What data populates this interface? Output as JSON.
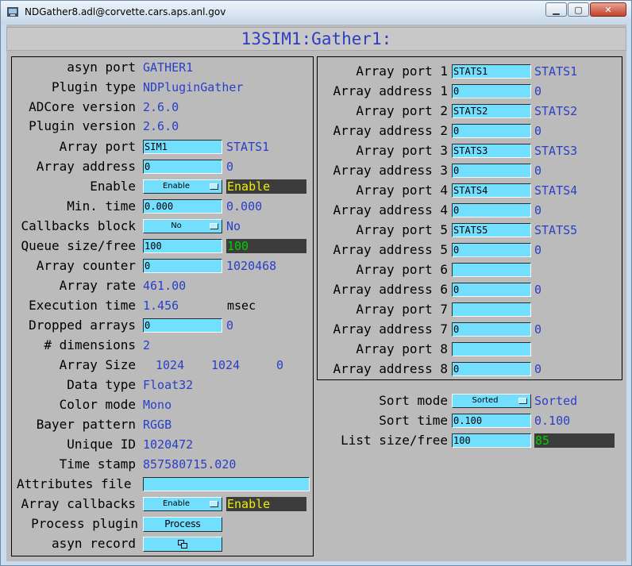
{
  "window": {
    "title": "NDGather8.adl@corvette.cars.aps.anl.gov",
    "controls": {
      "minimize": "▁",
      "maximize": "▢",
      "close": "✕"
    }
  },
  "header": {
    "title": "13SIM1:Gather1:"
  },
  "left": {
    "asyn_port": {
      "label": "asyn port",
      "value": "GATHER1"
    },
    "plugin_type": {
      "label": "Plugin type",
      "value": "NDPluginGather"
    },
    "adcore_version": {
      "label": "ADCore version",
      "value": "2.6.0"
    },
    "plugin_version": {
      "label": "Plugin version",
      "value": "2.6.0"
    },
    "array_port": {
      "label": "Array port",
      "input": "SIM1",
      "readback": "STATS1"
    },
    "array_address": {
      "label": "Array address",
      "input": "0",
      "readback": "0"
    },
    "enable": {
      "label": "Enable",
      "menu": "Enable",
      "readback": "Enable"
    },
    "min_time": {
      "label": "Min. time",
      "input": "0.000",
      "readback": "0.000"
    },
    "callbacks_block": {
      "label": "Callbacks block",
      "menu": "No",
      "readback": "No"
    },
    "queue_size": {
      "label": "Queue size/free",
      "input": "100",
      "readback": "100"
    },
    "array_counter": {
      "label": "Array counter",
      "input": "0",
      "readback": "1020468"
    },
    "array_rate": {
      "label": "Array rate",
      "value": "461.00"
    },
    "execution_time": {
      "label": "Execution time",
      "value": "1.456",
      "unit": "msec"
    },
    "dropped_arrays": {
      "label": "Dropped arrays",
      "input": "0",
      "readback": "0"
    },
    "dimensions": {
      "label": "# dimensions",
      "value": "2"
    },
    "array_size": {
      "label": "Array Size",
      "x": "1024",
      "y": "1024",
      "z": "0"
    },
    "data_type": {
      "label": "Data type",
      "value": "Float32"
    },
    "color_mode": {
      "label": "Color mode",
      "value": "Mono"
    },
    "bayer_pattern": {
      "label": "Bayer pattern",
      "value": "RGGB"
    },
    "unique_id": {
      "label": "Unique ID",
      "value": "1020472"
    },
    "time_stamp": {
      "label": "Time stamp",
      "value": "857580715.020"
    },
    "attributes_file": {
      "label": "Attributes file",
      "input": ""
    },
    "array_callbacks": {
      "label": "Array callbacks",
      "menu": "Enable",
      "readback": "Enable"
    },
    "process_plugin": {
      "label": "Process plugin",
      "button": "Process"
    },
    "asyn_record": {
      "label": "asyn record",
      "button_icon": "window-stack-icon"
    }
  },
  "right": {
    "ports": [
      {
        "port_label": "Array port 1",
        "port_input": "STATS1",
        "port_readback": "STATS1",
        "addr_label": "Array address 1",
        "addr_input": "0",
        "addr_readback": "0"
      },
      {
        "port_label": "Array port 2",
        "port_input": "STATS2",
        "port_readback": "STATS2",
        "addr_label": "Array address 2",
        "addr_input": "0",
        "addr_readback": "0"
      },
      {
        "port_label": "Array port 3",
        "port_input": "STATS3",
        "port_readback": "STATS3",
        "addr_label": "Array address 3",
        "addr_input": "0",
        "addr_readback": "0"
      },
      {
        "port_label": "Array port 4",
        "port_input": "STATS4",
        "port_readback": "STATS4",
        "addr_label": "Array address 4",
        "addr_input": "0",
        "addr_readback": "0"
      },
      {
        "port_label": "Array port 5",
        "port_input": "STATS5",
        "port_readback": "STATS5",
        "addr_label": "Array address 5",
        "addr_input": "0",
        "addr_readback": "0"
      },
      {
        "port_label": "Array port 6",
        "port_input": "",
        "port_readback": "",
        "addr_label": "Array address 6",
        "addr_input": "0",
        "addr_readback": "0"
      },
      {
        "port_label": "Array port 7",
        "port_input": "",
        "port_readback": "",
        "addr_label": "Array address 7",
        "addr_input": "0",
        "addr_readback": "0"
      },
      {
        "port_label": "Array port 8",
        "port_input": "",
        "port_readback": "",
        "addr_label": "Array address 8",
        "addr_input": "0",
        "addr_readback": "0"
      }
    ],
    "sort_mode": {
      "label": "Sort mode",
      "menu": "Sorted",
      "readback": "Sorted"
    },
    "sort_time": {
      "label": "Sort time",
      "input": "0.100",
      "readback": "0.100"
    },
    "list_size": {
      "label": "List size/free",
      "input": "100",
      "readback": "85"
    }
  },
  "colors": {
    "input_bg": "#73dfff",
    "monitor_text": "#2a3fc8",
    "alarm_yellow": "#f0f000",
    "ok_green": "#00d000",
    "dark_bg": "#3c3c3c",
    "panel_bg": "#bbbbbb"
  }
}
